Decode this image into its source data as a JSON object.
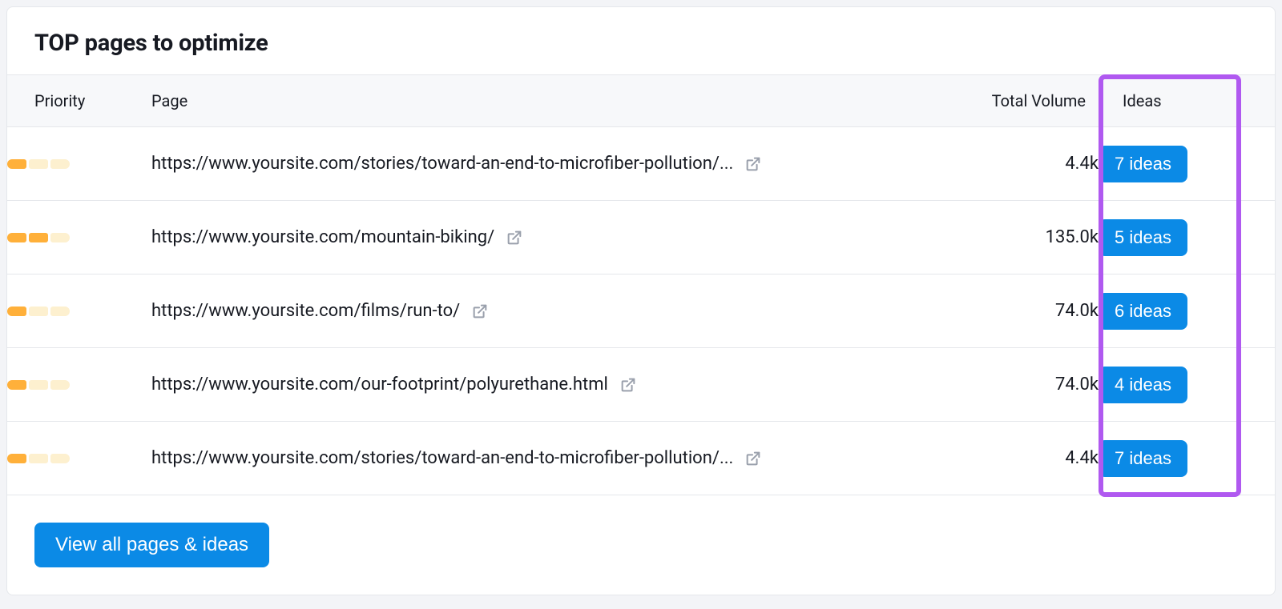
{
  "panel": {
    "title": "TOP pages to optimize",
    "columns": {
      "priority": "Priority",
      "page": "Page",
      "volume": "Total Volume",
      "ideas": "Ideas"
    },
    "rows": [
      {
        "priority_filled": 1,
        "url": "https://www.yoursite.com/stories/toward-an-end-to-microfiber-pollution/...",
        "volume": "4.4k",
        "ideas": "7 ideas"
      },
      {
        "priority_filled": 2,
        "url": "https://www.yoursite.com/mountain-biking/",
        "volume": "135.0k",
        "ideas": "5 ideas"
      },
      {
        "priority_filled": 1,
        "url": "https://www.yoursite.com/films/run-to/",
        "volume": "74.0k",
        "ideas": "6 ideas"
      },
      {
        "priority_filled": 1,
        "url": "https://www.yoursite.com/our-footprint/polyurethane.html",
        "volume": "74.0k",
        "ideas": "4 ideas"
      },
      {
        "priority_filled": 1,
        "url": "https://www.yoursite.com/stories/toward-an-end-to-microfiber-pollution/...",
        "volume": "4.4k",
        "ideas": "7 ideas"
      }
    ],
    "view_all_label": "View all pages & ideas"
  }
}
